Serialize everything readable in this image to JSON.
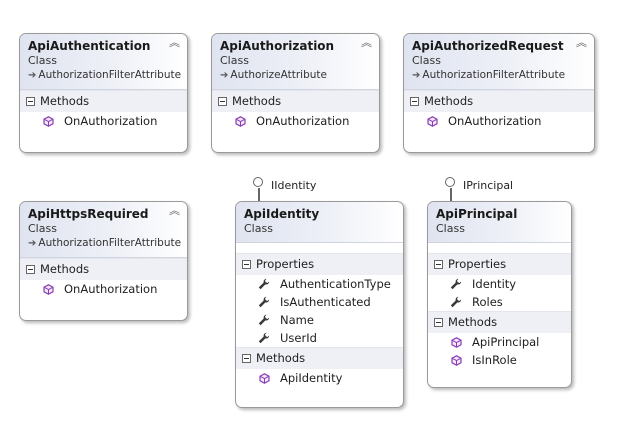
{
  "classes": {
    "api_authentication": {
      "name": "ApiAuthentication",
      "kind": "Class",
      "base": "AuthorizationFilterAttribute",
      "sections": [
        {
          "label": "Methods",
          "members": [
            "OnAuthorization"
          ]
        }
      ]
    },
    "api_authorization": {
      "name": "ApiAuthorization",
      "kind": "Class",
      "base": "AuthorizeAttribute",
      "sections": [
        {
          "label": "Methods",
          "members": [
            "OnAuthorization"
          ]
        }
      ]
    },
    "api_authorized_request": {
      "name": "ApiAuthorizedRequest",
      "kind": "Class",
      "base": "AuthorizationFilterAttribute",
      "sections": [
        {
          "label": "Methods",
          "members": [
            "OnAuthorization"
          ]
        }
      ]
    },
    "api_https_required": {
      "name": "ApiHttpsRequired",
      "kind": "Class",
      "base": "AuthorizationFilterAttribute",
      "sections": [
        {
          "label": "Methods",
          "members": [
            "OnAuthorization"
          ]
        }
      ]
    },
    "api_identity": {
      "name": "ApiIdentity",
      "kind": "Class",
      "interface": "IIdentity",
      "sections": [
        {
          "label": "Properties",
          "members": [
            "AuthenticationType",
            "IsAuthenticated",
            "Name",
            "UserId"
          ]
        },
        {
          "label": "Methods",
          "members": [
            "ApiIdentity"
          ]
        }
      ]
    },
    "api_principal": {
      "name": "ApiPrincipal",
      "kind": "Class",
      "interface": "IPrincipal",
      "sections": [
        {
          "label": "Properties",
          "members": [
            "Identity",
            "Roles"
          ]
        },
        {
          "label": "Methods",
          "members": [
            "ApiPrincipal",
            "IsInRole"
          ]
        }
      ]
    }
  },
  "icons": {
    "collapse": "double-chevron-up-icon",
    "inherits": "arrow-right-icon",
    "method": "method-cube-icon",
    "property": "property-wrench-icon",
    "section_toggle": "minus-box-icon",
    "interface": "interface-lollipop-icon"
  },
  "colors": {
    "method_icon": "#8a3cb5",
    "property_icon": "#3a3a3a",
    "header_gradient_start": "#dfe4f0",
    "section_bg": "#eef0f5",
    "border": "#9a9a9a"
  }
}
